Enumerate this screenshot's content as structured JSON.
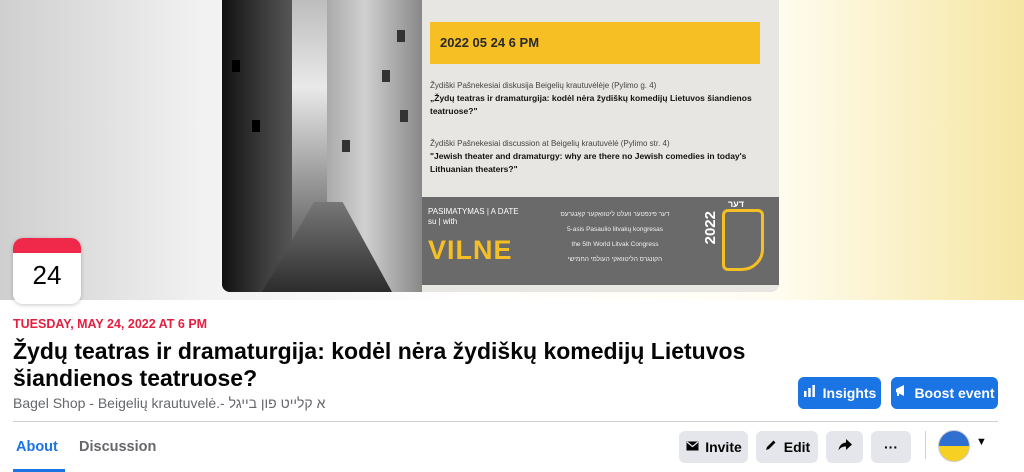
{
  "cover": {
    "poster": {
      "datetime": "2022 05 24   6 PM",
      "lt_intro": "Žydiški Pašnekesiai diskusija Beigelių krautuvėlėje (Pylimo g. 4)",
      "lt_title": "„Žydų teatras ir dramaturgija: kodėl nėra žydiškų komedijų Lietuvos šiandienos teatruose?\"",
      "en_intro": "Žydiški Pašnekesiai discussion at Beigelių krautuvėlė (Pylimo str. 4)",
      "en_title": "\"Jewish theater and dramaturgy: why are there no Jewish comedies in today's Lithuanian theaters?\"",
      "band_left": "PASIMATYMAS | A DATE",
      "band_left2": "su | with",
      "vilne": "VILNE",
      "band_mid1": "דער פינפטער וועלט ליטוואַקער קאָנגרעס",
      "band_mid2": "5-asis Pasaulio litvakų kongresas",
      "band_mid3": "the 5th World Litvak Congress",
      "band_mid4": "הקונגרס הליטוואקי העולמי החמישי",
      "year": "2022",
      "logo_text": "דער"
    }
  },
  "calendar": {
    "day": "24"
  },
  "event": {
    "date_line": "TUESDAY, MAY 24, 2022 AT 6 PM",
    "title": "Žydų teatras ir dramaturgija: kodėl nėra žydiškų komedijų Lietuvos šiandienos teatruose?",
    "host": "Bagel Shop - Beigelių krautuvelė.- א קלייט פון בייגל"
  },
  "actions": {
    "insights_label": "Insights",
    "boost_label": "Boost event",
    "invite_label": "Invite",
    "edit_label": "Edit",
    "more_label": "···"
  },
  "tabs": [
    {
      "label": "About",
      "active": true
    },
    {
      "label": "Discussion",
      "active": false
    }
  ],
  "colors": {
    "accent": "#1b74e4",
    "date_red": "#e41e3f",
    "poster_yellow": "#f6bf23"
  }
}
